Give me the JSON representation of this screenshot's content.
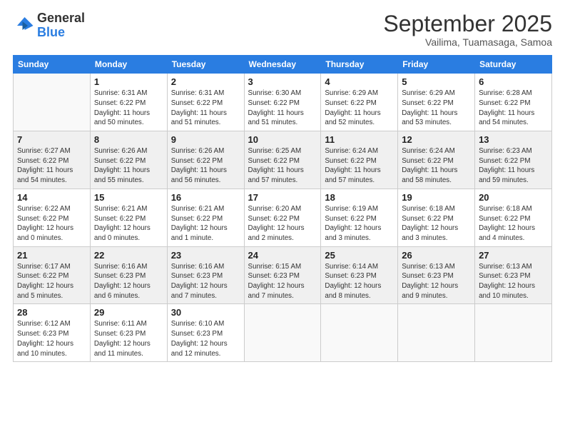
{
  "logo": {
    "general": "General",
    "blue": "Blue"
  },
  "header": {
    "month": "September 2025",
    "location": "Vailima, Tuamasaga, Samoa"
  },
  "weekdays": [
    "Sunday",
    "Monday",
    "Tuesday",
    "Wednesday",
    "Thursday",
    "Friday",
    "Saturday"
  ],
  "weeks": [
    [
      {
        "day": "",
        "info": ""
      },
      {
        "day": "1",
        "info": "Sunrise: 6:31 AM\nSunset: 6:22 PM\nDaylight: 11 hours\nand 50 minutes."
      },
      {
        "day": "2",
        "info": "Sunrise: 6:31 AM\nSunset: 6:22 PM\nDaylight: 11 hours\nand 51 minutes."
      },
      {
        "day": "3",
        "info": "Sunrise: 6:30 AM\nSunset: 6:22 PM\nDaylight: 11 hours\nand 51 minutes."
      },
      {
        "day": "4",
        "info": "Sunrise: 6:29 AM\nSunset: 6:22 PM\nDaylight: 11 hours\nand 52 minutes."
      },
      {
        "day": "5",
        "info": "Sunrise: 6:29 AM\nSunset: 6:22 PM\nDaylight: 11 hours\nand 53 minutes."
      },
      {
        "day": "6",
        "info": "Sunrise: 6:28 AM\nSunset: 6:22 PM\nDaylight: 11 hours\nand 54 minutes."
      }
    ],
    [
      {
        "day": "7",
        "info": "Sunrise: 6:27 AM\nSunset: 6:22 PM\nDaylight: 11 hours\nand 54 minutes."
      },
      {
        "day": "8",
        "info": "Sunrise: 6:26 AM\nSunset: 6:22 PM\nDaylight: 11 hours\nand 55 minutes."
      },
      {
        "day": "9",
        "info": "Sunrise: 6:26 AM\nSunset: 6:22 PM\nDaylight: 11 hours\nand 56 minutes."
      },
      {
        "day": "10",
        "info": "Sunrise: 6:25 AM\nSunset: 6:22 PM\nDaylight: 11 hours\nand 57 minutes."
      },
      {
        "day": "11",
        "info": "Sunrise: 6:24 AM\nSunset: 6:22 PM\nDaylight: 11 hours\nand 57 minutes."
      },
      {
        "day": "12",
        "info": "Sunrise: 6:24 AM\nSunset: 6:22 PM\nDaylight: 11 hours\nand 58 minutes."
      },
      {
        "day": "13",
        "info": "Sunrise: 6:23 AM\nSunset: 6:22 PM\nDaylight: 11 hours\nand 59 minutes."
      }
    ],
    [
      {
        "day": "14",
        "info": "Sunrise: 6:22 AM\nSunset: 6:22 PM\nDaylight: 12 hours\nand 0 minutes."
      },
      {
        "day": "15",
        "info": "Sunrise: 6:21 AM\nSunset: 6:22 PM\nDaylight: 12 hours\nand 0 minutes."
      },
      {
        "day": "16",
        "info": "Sunrise: 6:21 AM\nSunset: 6:22 PM\nDaylight: 12 hours\nand 1 minute."
      },
      {
        "day": "17",
        "info": "Sunrise: 6:20 AM\nSunset: 6:22 PM\nDaylight: 12 hours\nand 2 minutes."
      },
      {
        "day": "18",
        "info": "Sunrise: 6:19 AM\nSunset: 6:22 PM\nDaylight: 12 hours\nand 3 minutes."
      },
      {
        "day": "19",
        "info": "Sunrise: 6:18 AM\nSunset: 6:22 PM\nDaylight: 12 hours\nand 3 minutes."
      },
      {
        "day": "20",
        "info": "Sunrise: 6:18 AM\nSunset: 6:22 PM\nDaylight: 12 hours\nand 4 minutes."
      }
    ],
    [
      {
        "day": "21",
        "info": "Sunrise: 6:17 AM\nSunset: 6:22 PM\nDaylight: 12 hours\nand 5 minutes."
      },
      {
        "day": "22",
        "info": "Sunrise: 6:16 AM\nSunset: 6:23 PM\nDaylight: 12 hours\nand 6 minutes."
      },
      {
        "day": "23",
        "info": "Sunrise: 6:16 AM\nSunset: 6:23 PM\nDaylight: 12 hours\nand 7 minutes."
      },
      {
        "day": "24",
        "info": "Sunrise: 6:15 AM\nSunset: 6:23 PM\nDaylight: 12 hours\nand 7 minutes."
      },
      {
        "day": "25",
        "info": "Sunrise: 6:14 AM\nSunset: 6:23 PM\nDaylight: 12 hours\nand 8 minutes."
      },
      {
        "day": "26",
        "info": "Sunrise: 6:13 AM\nSunset: 6:23 PM\nDaylight: 12 hours\nand 9 minutes."
      },
      {
        "day": "27",
        "info": "Sunrise: 6:13 AM\nSunset: 6:23 PM\nDaylight: 12 hours\nand 10 minutes."
      }
    ],
    [
      {
        "day": "28",
        "info": "Sunrise: 6:12 AM\nSunset: 6:23 PM\nDaylight: 12 hours\nand 10 minutes."
      },
      {
        "day": "29",
        "info": "Sunrise: 6:11 AM\nSunset: 6:23 PM\nDaylight: 12 hours\nand 11 minutes."
      },
      {
        "day": "30",
        "info": "Sunrise: 6:10 AM\nSunset: 6:23 PM\nDaylight: 12 hours\nand 12 minutes."
      },
      {
        "day": "",
        "info": ""
      },
      {
        "day": "",
        "info": ""
      },
      {
        "day": "",
        "info": ""
      },
      {
        "day": "",
        "info": ""
      }
    ]
  ]
}
